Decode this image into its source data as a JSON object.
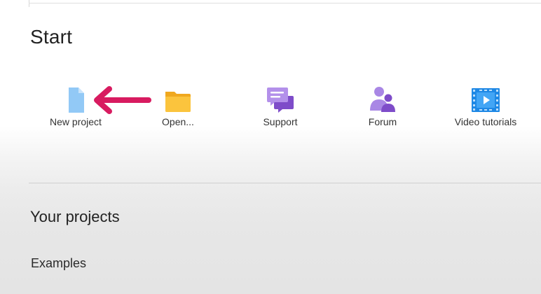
{
  "start": {
    "title": "Start",
    "tiles": [
      {
        "label": "New project",
        "icon": "document-icon",
        "color": "#8fc6f5"
      },
      {
        "label": "Open...",
        "icon": "folder-icon",
        "color": "#f7b733"
      },
      {
        "label": "Support",
        "icon": "chat-bubbles-icon",
        "color": "#8b5fd6"
      },
      {
        "label": "Forum",
        "icon": "people-icon",
        "color": "#8b5fd6"
      },
      {
        "label": "Video tutorials",
        "icon": "film-icon",
        "color": "#1e88e5"
      }
    ]
  },
  "annotation": {
    "icon": "arrow-left-icon",
    "color": "#d81b60"
  },
  "projects": {
    "title": "Your projects",
    "examples_label": "Examples"
  }
}
